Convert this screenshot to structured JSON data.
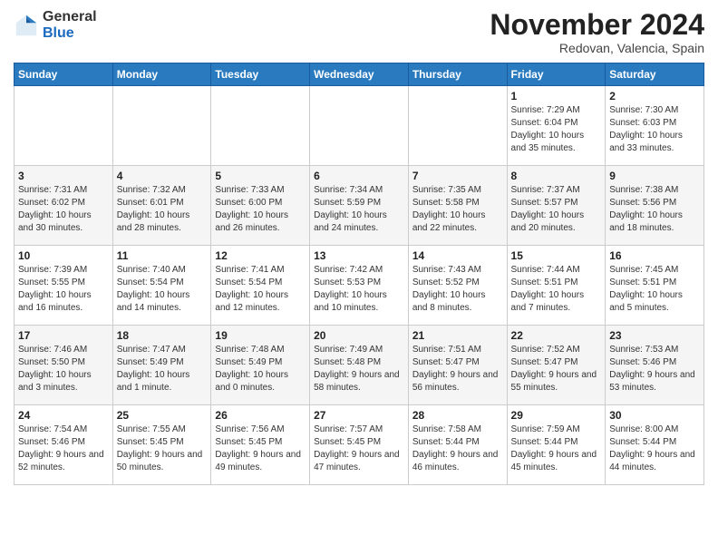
{
  "header": {
    "logo_line1": "General",
    "logo_line2": "Blue",
    "month": "November 2024",
    "location": "Redovan, Valencia, Spain"
  },
  "weekdays": [
    "Sunday",
    "Monday",
    "Tuesday",
    "Wednesday",
    "Thursday",
    "Friday",
    "Saturday"
  ],
  "weeks": [
    [
      {
        "day": "",
        "info": ""
      },
      {
        "day": "",
        "info": ""
      },
      {
        "day": "",
        "info": ""
      },
      {
        "day": "",
        "info": ""
      },
      {
        "day": "",
        "info": ""
      },
      {
        "day": "1",
        "info": "Sunrise: 7:29 AM\nSunset: 6:04 PM\nDaylight: 10 hours and 35 minutes."
      },
      {
        "day": "2",
        "info": "Sunrise: 7:30 AM\nSunset: 6:03 PM\nDaylight: 10 hours and 33 minutes."
      }
    ],
    [
      {
        "day": "3",
        "info": "Sunrise: 7:31 AM\nSunset: 6:02 PM\nDaylight: 10 hours and 30 minutes."
      },
      {
        "day": "4",
        "info": "Sunrise: 7:32 AM\nSunset: 6:01 PM\nDaylight: 10 hours and 28 minutes."
      },
      {
        "day": "5",
        "info": "Sunrise: 7:33 AM\nSunset: 6:00 PM\nDaylight: 10 hours and 26 minutes."
      },
      {
        "day": "6",
        "info": "Sunrise: 7:34 AM\nSunset: 5:59 PM\nDaylight: 10 hours and 24 minutes."
      },
      {
        "day": "7",
        "info": "Sunrise: 7:35 AM\nSunset: 5:58 PM\nDaylight: 10 hours and 22 minutes."
      },
      {
        "day": "8",
        "info": "Sunrise: 7:37 AM\nSunset: 5:57 PM\nDaylight: 10 hours and 20 minutes."
      },
      {
        "day": "9",
        "info": "Sunrise: 7:38 AM\nSunset: 5:56 PM\nDaylight: 10 hours and 18 minutes."
      }
    ],
    [
      {
        "day": "10",
        "info": "Sunrise: 7:39 AM\nSunset: 5:55 PM\nDaylight: 10 hours and 16 minutes."
      },
      {
        "day": "11",
        "info": "Sunrise: 7:40 AM\nSunset: 5:54 PM\nDaylight: 10 hours and 14 minutes."
      },
      {
        "day": "12",
        "info": "Sunrise: 7:41 AM\nSunset: 5:54 PM\nDaylight: 10 hours and 12 minutes."
      },
      {
        "day": "13",
        "info": "Sunrise: 7:42 AM\nSunset: 5:53 PM\nDaylight: 10 hours and 10 minutes."
      },
      {
        "day": "14",
        "info": "Sunrise: 7:43 AM\nSunset: 5:52 PM\nDaylight: 10 hours and 8 minutes."
      },
      {
        "day": "15",
        "info": "Sunrise: 7:44 AM\nSunset: 5:51 PM\nDaylight: 10 hours and 7 minutes."
      },
      {
        "day": "16",
        "info": "Sunrise: 7:45 AM\nSunset: 5:51 PM\nDaylight: 10 hours and 5 minutes."
      }
    ],
    [
      {
        "day": "17",
        "info": "Sunrise: 7:46 AM\nSunset: 5:50 PM\nDaylight: 10 hours and 3 minutes."
      },
      {
        "day": "18",
        "info": "Sunrise: 7:47 AM\nSunset: 5:49 PM\nDaylight: 10 hours and 1 minute."
      },
      {
        "day": "19",
        "info": "Sunrise: 7:48 AM\nSunset: 5:49 PM\nDaylight: 10 hours and 0 minutes."
      },
      {
        "day": "20",
        "info": "Sunrise: 7:49 AM\nSunset: 5:48 PM\nDaylight: 9 hours and 58 minutes."
      },
      {
        "day": "21",
        "info": "Sunrise: 7:51 AM\nSunset: 5:47 PM\nDaylight: 9 hours and 56 minutes."
      },
      {
        "day": "22",
        "info": "Sunrise: 7:52 AM\nSunset: 5:47 PM\nDaylight: 9 hours and 55 minutes."
      },
      {
        "day": "23",
        "info": "Sunrise: 7:53 AM\nSunset: 5:46 PM\nDaylight: 9 hours and 53 minutes."
      }
    ],
    [
      {
        "day": "24",
        "info": "Sunrise: 7:54 AM\nSunset: 5:46 PM\nDaylight: 9 hours and 52 minutes."
      },
      {
        "day": "25",
        "info": "Sunrise: 7:55 AM\nSunset: 5:45 PM\nDaylight: 9 hours and 50 minutes."
      },
      {
        "day": "26",
        "info": "Sunrise: 7:56 AM\nSunset: 5:45 PM\nDaylight: 9 hours and 49 minutes."
      },
      {
        "day": "27",
        "info": "Sunrise: 7:57 AM\nSunset: 5:45 PM\nDaylight: 9 hours and 47 minutes."
      },
      {
        "day": "28",
        "info": "Sunrise: 7:58 AM\nSunset: 5:44 PM\nDaylight: 9 hours and 46 minutes."
      },
      {
        "day": "29",
        "info": "Sunrise: 7:59 AM\nSunset: 5:44 PM\nDaylight: 9 hours and 45 minutes."
      },
      {
        "day": "30",
        "info": "Sunrise: 8:00 AM\nSunset: 5:44 PM\nDaylight: 9 hours and 44 minutes."
      }
    ]
  ]
}
